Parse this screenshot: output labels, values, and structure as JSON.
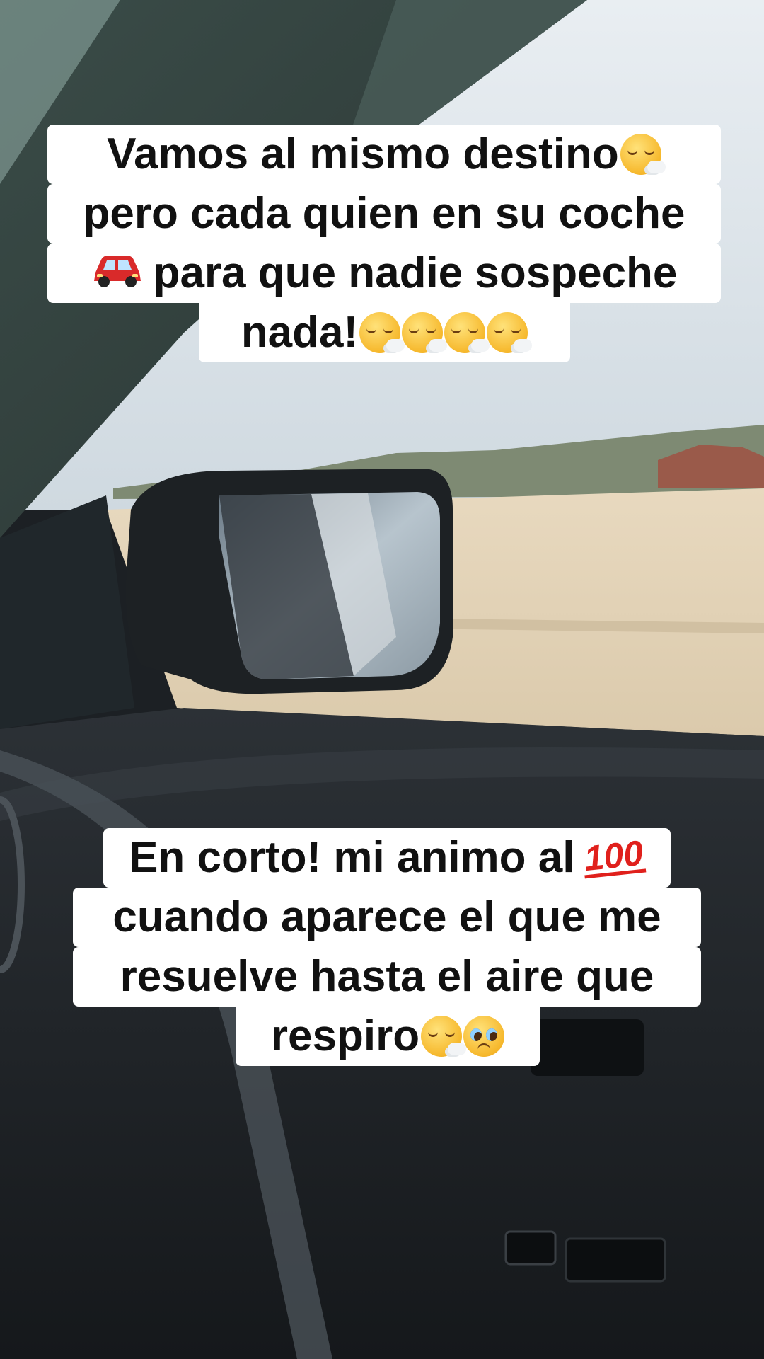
{
  "caption_top": {
    "line1": "Vamos al mismo destino",
    "line2": "pero cada quien en su coche",
    "line3": "para que nadie sospeche",
    "line4": "nada!"
  },
  "caption_bottom": {
    "line1": "En corto! mi animo al",
    "line2": "cuando aparece el que me",
    "line3": "resuelve hasta el aire que",
    "line4": "respiro"
  },
  "emojis": {
    "face_exhaling": "face-exhaling-icon",
    "red_car": "red-car-icon",
    "hundred_points": "100",
    "pleading_face": "pleading-face-icon"
  },
  "colors": {
    "caption_bg": "#ffffff",
    "caption_text": "#111111",
    "hundred_red": "#e0201c",
    "car_red": "#d92a2a"
  }
}
